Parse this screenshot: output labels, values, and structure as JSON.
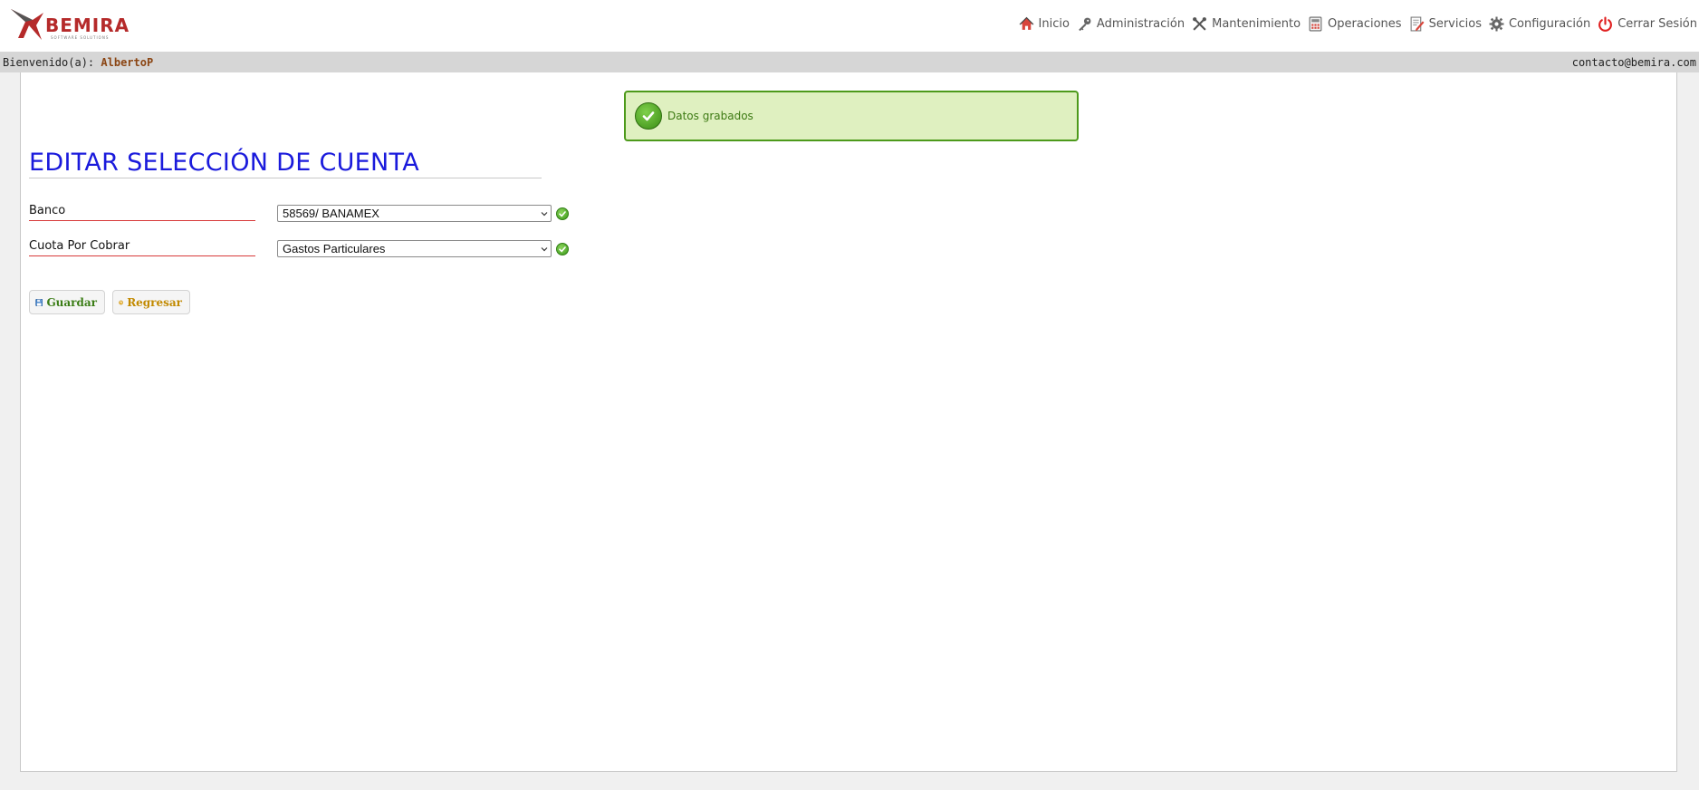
{
  "header": {
    "logo": {
      "text": "BEMIRA",
      "tagline": "SOFTWARE SOLUTIONS"
    },
    "nav": [
      {
        "label": "Inicio",
        "icon": "home-icon"
      },
      {
        "label": "Administración",
        "icon": "key-icon"
      },
      {
        "label": "Mantenimiento",
        "icon": "tools-icon"
      },
      {
        "label": "Operaciones",
        "icon": "calculator-icon"
      },
      {
        "label": "Servicios",
        "icon": "document-edit-icon"
      },
      {
        "label": "Configuración",
        "icon": "gear-icon"
      },
      {
        "label": "Cerrar Sesión",
        "icon": "power-icon"
      }
    ]
  },
  "welcome": {
    "prefix": "Bienvenido(a):",
    "user": "AlbertoP",
    "email": "contacto@bemira.com"
  },
  "alert": {
    "message": "Datos grabados",
    "color": "#dff0c0"
  },
  "form": {
    "title": "EDITAR SELECCIÓN DE CUENTA",
    "fields": [
      {
        "label": "Banco",
        "value": "58569/ BANAMEX"
      },
      {
        "label": "Cuota Por Cobrar",
        "value": "Gastos Particulares"
      }
    ],
    "buttons": {
      "save": "Guardar",
      "back": "Regresar"
    }
  },
  "colors": {
    "title": "#1a1adc",
    "label_underline": "#d83a3a",
    "save": "#3b7d16",
    "back": "#c28a00"
  }
}
